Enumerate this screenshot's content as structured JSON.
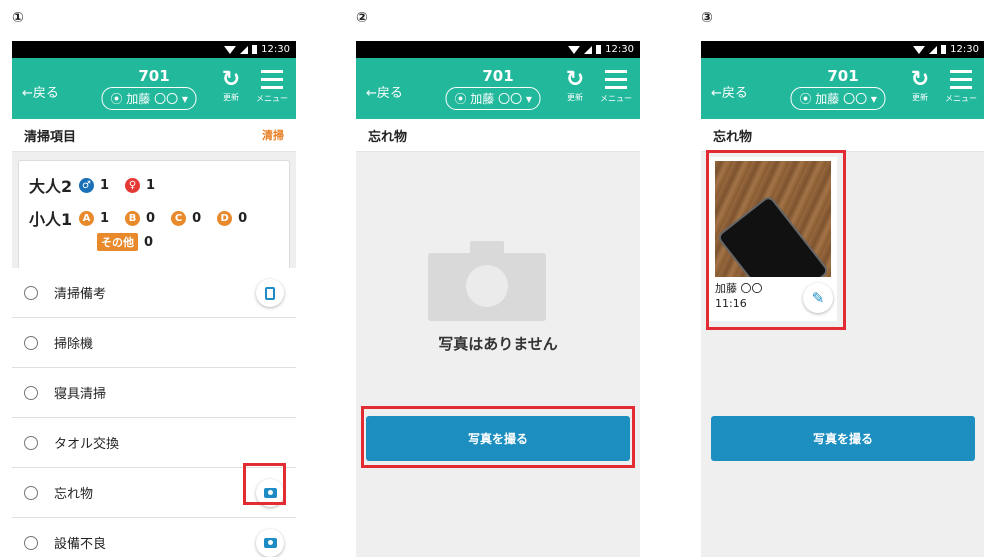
{
  "colors": {
    "header": "#22b89c",
    "accent_orange": "#e87e24",
    "button_blue": "#1c8ebf",
    "highlight_red": "#e32b33"
  },
  "panels": [
    {
      "number": "①",
      "status_time": "12:30",
      "header": {
        "back": "←戻る",
        "room": "701",
        "staff": "⦿ 加藤 〇〇 ▾",
        "refresh": "更新",
        "menu": "メニュー"
      },
      "section_title": "清掃項目",
      "section_tag": "清掃",
      "guests": {
        "adult_label": "大人2",
        "adult_male": "1",
        "adult_female": "1",
        "child_label": "小人1",
        "child_a": "1",
        "child_b": "0",
        "child_c": "0",
        "child_d": "0",
        "other_label": "その他",
        "other_count": "0"
      },
      "items": [
        {
          "label": "清掃備考",
          "icon": "clipboard-icon"
        },
        {
          "label": "掃除機",
          "icon": ""
        },
        {
          "label": "寝具清掃",
          "icon": ""
        },
        {
          "label": "タオル交換",
          "icon": ""
        },
        {
          "label": "忘れ物",
          "icon": "camera-icon"
        },
        {
          "label": "設備不良",
          "icon": "camera-icon"
        }
      ]
    },
    {
      "number": "②",
      "status_time": "12:30",
      "header": {
        "back": "←戻る",
        "room": "701",
        "staff": "⦿ 加藤 〇〇 ▾",
        "refresh": "更新",
        "menu": "メニュー"
      },
      "section_title": "忘れ物",
      "empty_text": "写真はありません",
      "button": "写真を撮る"
    },
    {
      "number": "③",
      "status_time": "12:30",
      "header": {
        "back": "←戻る",
        "room": "701",
        "staff": "⦿ 加藤 〇〇 ▾",
        "refresh": "更新",
        "menu": "メニュー"
      },
      "section_title": "忘れ物",
      "photo": {
        "author": "加藤 〇〇",
        "time": "11:16"
      },
      "button": "写真を撮る"
    }
  ]
}
